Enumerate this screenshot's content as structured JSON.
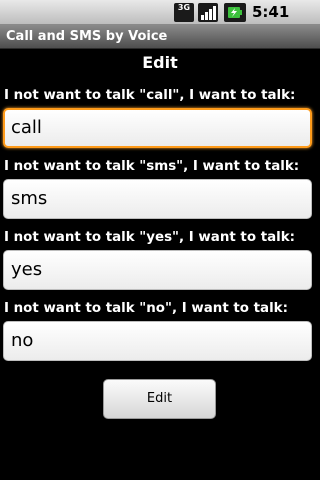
{
  "status_bar": {
    "network_label": "3G",
    "time": "5:41 PM",
    "icons": [
      "3g-icon",
      "signal-icon",
      "battery-icon"
    ]
  },
  "title_bar": {
    "title": "Call and SMS by Voice"
  },
  "main": {
    "heading": "Edit",
    "fields": [
      {
        "label": "I not want to talk \"call\", I want to talk:",
        "value": "call",
        "focused": true
      },
      {
        "label": "I not want to talk \"sms\", I want to talk:",
        "value": "sms",
        "focused": false
      },
      {
        "label": "I not want to talk \"yes\", I want to talk:",
        "value": "yes",
        "focused": false
      },
      {
        "label": "I not want to talk \"no\", I want to talk:",
        "value": "no",
        "focused": false
      }
    ],
    "button_label": "Edit"
  },
  "colors": {
    "background": "#000000",
    "focus_border": "#ff9b1a",
    "text_light": "#ffffff"
  }
}
